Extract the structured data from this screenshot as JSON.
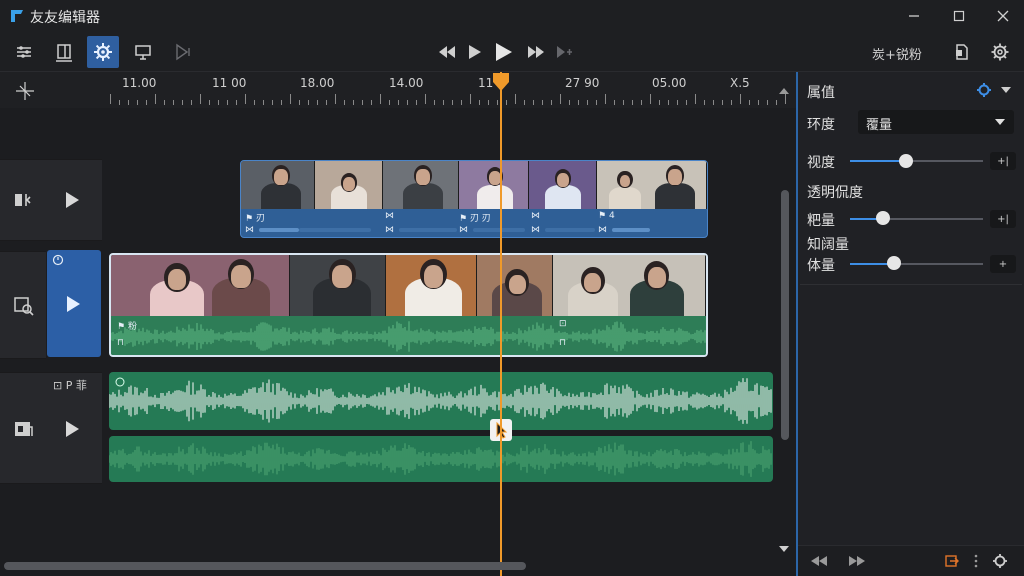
{
  "app": {
    "title": "友友编辑器"
  },
  "icons": {
    "logo": "app-logo-icon",
    "minimize": "minimize-icon",
    "maximize": "maximize-icon",
    "close": "close-icon",
    "tools": [
      "mixer-icon",
      "layout-icon",
      "gear-icon",
      "screen-icon",
      "play-next-icon"
    ],
    "transport": [
      "rewind-icon",
      "play-icon",
      "play-large-icon",
      "fast-forward-icon",
      "skip-icon"
    ],
    "right": [
      "file-icon",
      "settings-icon"
    ]
  },
  "toolbar": {
    "right_label": "炭+锐粉"
  },
  "ruler": {
    "labels": [
      "11.00",
      "11 00",
      "18.00",
      "14.00",
      "11",
      "27 90",
      "05.00",
      "X.5"
    ]
  },
  "tracks": {
    "audio_label": "⊡ P 菲",
    "clip1": {
      "labels": [
        "刃",
        "",
        "刃 刃",
        "",
        "4"
      ]
    },
    "clip2": {
      "labels": [
        "粉",
        "",
        ""
      ]
    }
  },
  "panel": {
    "title": "属值",
    "env_label": "环度",
    "env_value": "覆量",
    "rows": [
      {
        "label": "视度",
        "value": 0.42,
        "btn": "+|"
      },
      {
        "label": "透明侃度",
        "value": null,
        "btn": ""
      },
      {
        "label": "粑量",
        "value": 0.25,
        "btn": "+|"
      },
      {
        "label": "知阔量",
        "value": null,
        "btn": ""
      },
      {
        "label": "体量",
        "value": 0.33,
        "btn": "+"
      }
    ]
  },
  "colors": {
    "accent": "#2f5fa0",
    "playhead": "#f09a2a",
    "audio": "#2e7d57",
    "clip": "#2f5f96"
  }
}
